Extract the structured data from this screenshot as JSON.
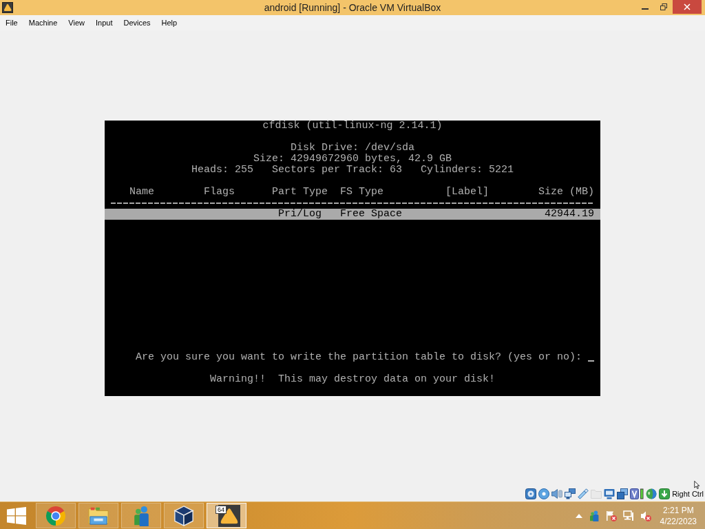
{
  "window": {
    "title": "android [Running] - Oracle VM VirtualBox"
  },
  "menu": [
    "File",
    "Machine",
    "View",
    "Input",
    "Devices",
    "Help"
  ],
  "terminal": {
    "title": "cfdisk (util-linux-ng 2.14.1)",
    "disk_drive": "Disk Drive: /dev/sda",
    "size": "Size: 42949672960 bytes, 42.9 GB",
    "geometry": [
      "Heads: 255",
      "Sectors per Track: 63",
      "Cylinders: 5221"
    ],
    "columns": [
      "Name",
      "Flags",
      "Part Type",
      "FS Type",
      "[Label]",
      "Size (MB)"
    ],
    "rows": [
      {
        "part_type": "Pri/Log",
        "fs_type": "Free Space",
        "size_mb": "42944.19",
        "selected": true
      }
    ],
    "prompt": "Are you sure you want to write the partition table to disk? (yes or no):",
    "warning": "Warning!!  This may destroy data on your disk!"
  },
  "status_bar": {
    "indicators": [
      {
        "kind": "hard-disk",
        "disabled": false
      },
      {
        "kind": "optical-disc",
        "disabled": false
      },
      {
        "kind": "audio",
        "disabled": false
      },
      {
        "kind": "network",
        "disabled": false
      },
      {
        "kind": "usb",
        "disabled": false
      },
      {
        "kind": "shared-folders",
        "disabled": true
      },
      {
        "kind": "display",
        "disabled": false
      },
      {
        "kind": "capture",
        "disabled": false
      },
      {
        "kind": "vt-x",
        "disabled": false
      },
      {
        "kind": "mouse",
        "disabled": false
      },
      {
        "kind": "keyboard",
        "disabled": false
      }
    ],
    "host_key": "Right Ctrl"
  },
  "taskbar": {
    "apps": [
      {
        "kind": "browser",
        "selected": false
      },
      {
        "kind": "folder",
        "selected": false
      },
      {
        "kind": "people",
        "selected": false
      },
      {
        "kind": "cube",
        "selected": false
      },
      {
        "kind": "vm",
        "badge": "64",
        "selected": true
      }
    ],
    "clock_time": "2:21 PM",
    "clock_date": "4/22/2023"
  }
}
